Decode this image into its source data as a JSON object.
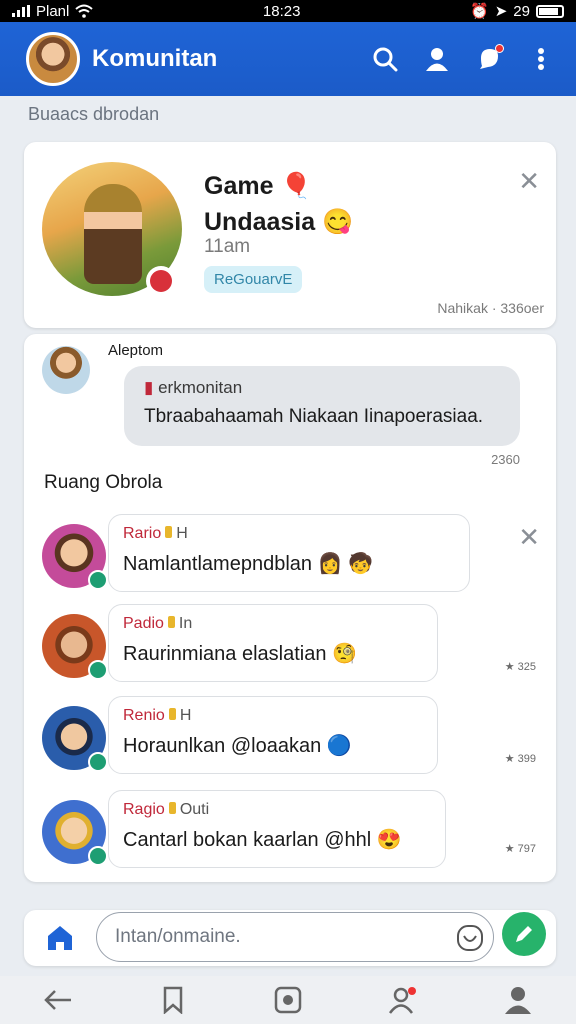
{
  "status_bar": {
    "carrier": "Planl",
    "time": "18:23",
    "battery": "29"
  },
  "header": {
    "title": "Komunitan"
  },
  "breadcrumb": "Buaacs dbrodan",
  "community": {
    "title": "Game",
    "title_line2": "Undaasia",
    "subtitle": "11am",
    "tag": "ReGouarvE",
    "meta": "Nahikak · 336oer"
  },
  "post": {
    "author": "Aleptom",
    "heading": "erkmonitan",
    "body": "Tbraabahaamah Niakaan Iinapoerasiaa.",
    "time": "2360"
  },
  "section_title": "Ruang Obrola",
  "chats": [
    {
      "name": "Rario",
      "extra": "H",
      "text": "Namlantlamepndblan",
      "side": "",
      "avatar_color": "#c44b9a"
    },
    {
      "name": "Padio",
      "extra": "In",
      "text": "Raurinmiana elaslatian",
      "side": "325",
      "avatar_color": "#c8562a"
    },
    {
      "name": "Renio",
      "extra": "H",
      "text": "Horaunlkan @loaakan",
      "side": "399",
      "avatar_color": "#2a5dab"
    },
    {
      "name": "Ragio",
      "extra": "Outi",
      "text": "Cantarl bokan kaarlan @hhl",
      "side": "797",
      "avatar_color": "#3f6fcf"
    }
  ],
  "composer": {
    "placeholder": "Intan/onmaine."
  },
  "colors": {
    "primary": "#1f64d6",
    "accent_green": "#27b36b",
    "name_red": "#c0283a"
  },
  "icons": {
    "header": [
      "search-icon",
      "person-icon",
      "notification-icon",
      "more-vert-icon"
    ],
    "nav": [
      "back-icon",
      "bookmark-icon",
      "square-icon",
      "people-icon",
      "profile-icon"
    ]
  }
}
